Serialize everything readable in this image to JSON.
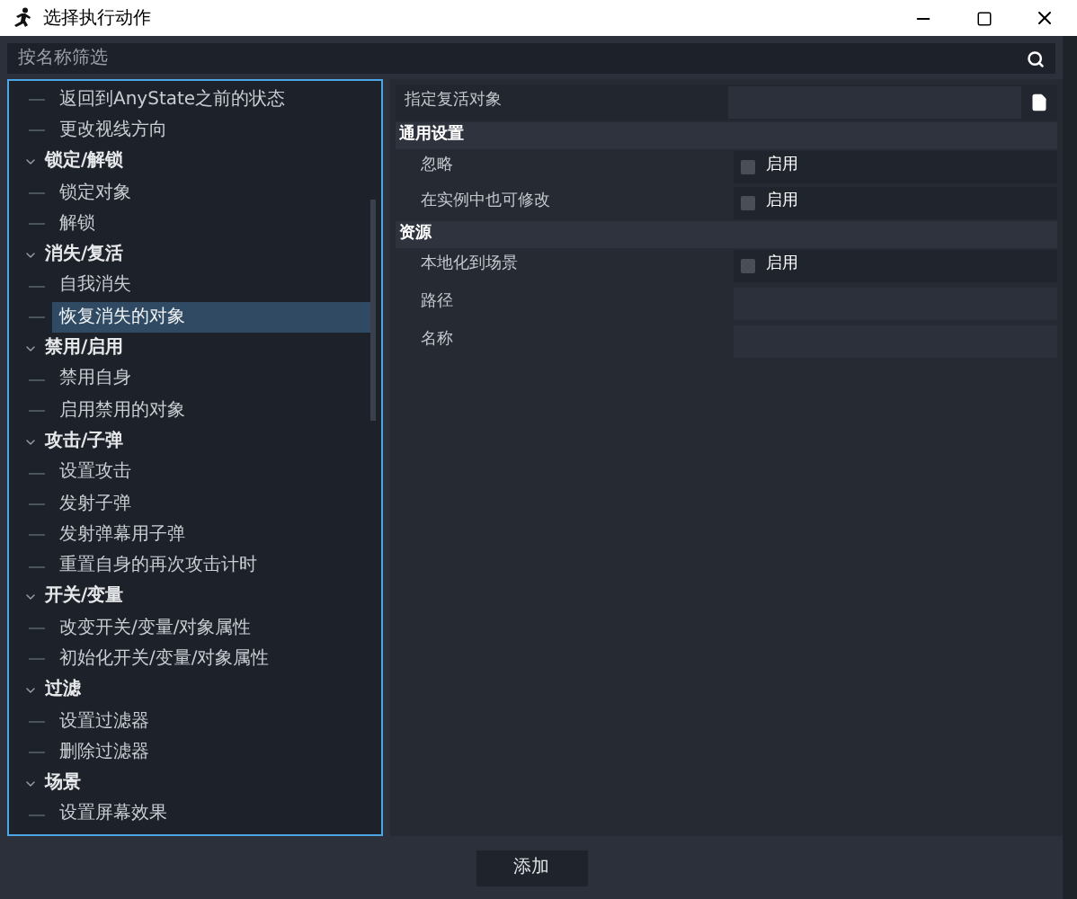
{
  "window": {
    "title": "选择执行动作"
  },
  "filter": {
    "placeholder": "按名称筛选"
  },
  "tree": [
    {
      "children": [
        {
          "label": "返回到AnyState之前的状态",
          "selected": false
        },
        {
          "label": "更改视线方向",
          "selected": false
        }
      ]
    },
    {
      "label": "锁定/解锁",
      "expanded": true,
      "children": [
        {
          "label": "锁定对象",
          "selected": false
        },
        {
          "label": "解锁",
          "selected": false
        }
      ]
    },
    {
      "label": "消失/复活",
      "expanded": true,
      "children": [
        {
          "label": "自我消失",
          "selected": false
        },
        {
          "label": "恢复消失的对象",
          "selected": true
        }
      ]
    },
    {
      "label": "禁用/启用",
      "expanded": true,
      "children": [
        {
          "label": "禁用自身",
          "selected": false
        },
        {
          "label": "启用禁用的对象",
          "selected": false
        }
      ]
    },
    {
      "label": "攻击/子弹",
      "expanded": true,
      "children": [
        {
          "label": "设置攻击",
          "selected": false
        },
        {
          "label": "发射子弹",
          "selected": false
        },
        {
          "label": "发射弹幕用子弹",
          "selected": false
        },
        {
          "label": "重置自身的再次攻击计时",
          "selected": false
        }
      ]
    },
    {
      "label": "开关/变量",
      "expanded": true,
      "children": [
        {
          "label": "改变开关/变量/对象属性",
          "selected": false
        },
        {
          "label": "初始化开关/变量/对象属性",
          "selected": false
        }
      ]
    },
    {
      "label": "过滤",
      "expanded": true,
      "children": [
        {
          "label": "设置过滤器",
          "selected": false
        },
        {
          "label": "删除过滤器",
          "selected": false
        }
      ]
    },
    {
      "label": "场景",
      "expanded": true,
      "children": [
        {
          "label": "设置屏幕效果",
          "selected": false
        }
      ]
    }
  ],
  "properties": [
    {
      "kind": "file",
      "label": "指定复活对象"
    },
    {
      "kind": "section",
      "label": "通用设置"
    },
    {
      "kind": "checkbox",
      "label": "忽略",
      "text": "启用",
      "checked": false
    },
    {
      "kind": "checkbox",
      "label": "在实例中也可修改",
      "text": "启用",
      "checked": false
    },
    {
      "kind": "section",
      "label": "资源"
    },
    {
      "kind": "checkbox",
      "label": "本地化到场景",
      "text": "启用",
      "checked": false
    },
    {
      "kind": "field",
      "label": "路径"
    },
    {
      "kind": "field",
      "label": "名称"
    }
  ],
  "add_button": "添加"
}
